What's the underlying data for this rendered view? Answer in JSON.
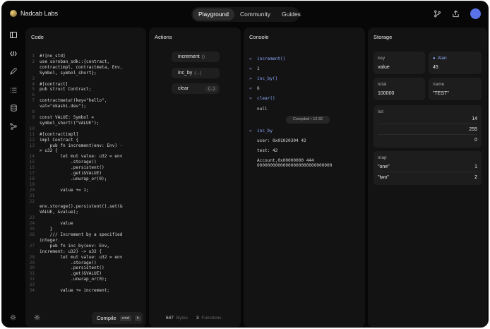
{
  "brand": {
    "name": "Nadcab Labs"
  },
  "nav": {
    "tabs": [
      "Playground",
      "Community",
      "Guides"
    ],
    "active": 0
  },
  "header_icons": [
    "branch-icon",
    "share-icon"
  ],
  "rail": {
    "icons": [
      "sidebar-toggle-icon",
      "code-icon",
      "rocket-icon",
      "list-icon",
      "database-icon",
      "network-icon"
    ],
    "bottom_icon": "theme-icon"
  },
  "code_panel": {
    "title": "Code",
    "lines": [
      "#![no_std]",
      "use soroban_sdk::{contract,",
      "contractimpl, contractmeta, Env,",
      "Symbol, symbol_short};",
      "",
      "#[contract]",
      "pub struct Contract;",
      "",
      "contractmeta!(key=\"hello\",",
      "val=\"okashi.dev\");",
      "",
      "const VALUE: Symbol =",
      "symbol_short!(\"VALUE\");",
      "",
      "#[contractimpl]",
      "impl Contract {",
      "    pub fn increment(env: Env) -",
      "> u32 {",
      "        let mut value: u32 = env",
      "            .storage()",
      "            .persistent()",
      "            .get(&VALUE)",
      "            .unwrap_or(0);",
      "",
      "        value += 1;",
      "",
      "",
      "env.storage().persistent().set(&",
      "VALUE, &value);",
      "",
      "        value",
      "    }",
      "    /// Increment by a specified",
      "integer.",
      "    pub fn inc_by(env: Env,",
      "increment: u32) -> u32 {",
      "        let mut value: u32 = env",
      "            .storage()",
      "            .persistent()",
      "            .get(&VALUE)",
      "            .unwrap_or(0);",
      "",
      "        value += increment;"
    ],
    "line_numbers": [
      "1",
      "2",
      "",
      "",
      "3",
      "4",
      "5",
      "6",
      "7",
      "",
      "8",
      "9",
      "",
      "10",
      "11",
      "12",
      "13",
      "",
      "14",
      "15",
      "16",
      "17",
      "18",
      "19",
      "20",
      "21",
      "22",
      "",
      "",
      "23",
      "24",
      "25",
      "26",
      "",
      "27",
      "",
      "28",
      "29",
      "30",
      "31",
      "32",
      "33",
      "34"
    ],
    "compile": {
      "label": "Compile",
      "shortcut_mod": "cmd",
      "shortcut_key": "k"
    }
  },
  "actions_panel": {
    "title": "Actions",
    "buttons": [
      {
        "label": "increment",
        "arg": "()"
      },
      {
        "label": "inc_by",
        "arg": "(...)"
      },
      {
        "label": "clear",
        "arg": "(...)"
      }
    ],
    "footer": {
      "bytes_value": "647",
      "bytes_label": "Bytes",
      "functions_value": "3",
      "functions_label": "Functions"
    }
  },
  "console_panel": {
    "title": "Console",
    "entries": [
      {
        "marker": "»",
        "text": "increment()",
        "kind": "fn"
      },
      {
        "marker": "«",
        "text": "1",
        "kind": "out"
      },
      {
        "marker": "»",
        "text": "inc_by()",
        "kind": "fn"
      },
      {
        "marker": "«",
        "text": "6",
        "kind": "out"
      },
      {
        "marker": "»",
        "text": "clear()",
        "kind": "fn"
      },
      {
        "marker": "",
        "text": "null",
        "kind": "sub"
      }
    ],
    "compiled_badge": "Compiled • 12:32",
    "entries2": [
      {
        "marker": "»",
        "text": "inc_by",
        "kind": "fn"
      },
      {
        "marker": "",
        "text": "user: 0x01020304 42",
        "kind": "sub"
      },
      {
        "marker": "",
        "text": "test: 42",
        "kind": "sub"
      }
    ],
    "account_lines": [
      "Account,0x00000000 444",
      "00000000000000000000000000000"
    ]
  },
  "storage_panel": {
    "title": "Storage",
    "key": {
      "label": "key",
      "value": "value"
    },
    "user": {
      "label": "Alan",
      "value": "45",
      "icon": "user-icon"
    },
    "total": {
      "label": "total",
      "value": "100000"
    },
    "name": {
      "label": "name",
      "value": "\"TEST\""
    },
    "list": {
      "label": "list",
      "values": [
        "14",
        "255",
        "0"
      ]
    },
    "map": {
      "label": "map",
      "entries": [
        {
          "key": "\"one\"",
          "value": "1"
        },
        {
          "key": "\"two\"",
          "value": "2"
        }
      ]
    }
  },
  "colors": {
    "background": "#070707",
    "panel": "#131313",
    "accent": "#8ea9ff",
    "avatar": "#5a73e8"
  }
}
